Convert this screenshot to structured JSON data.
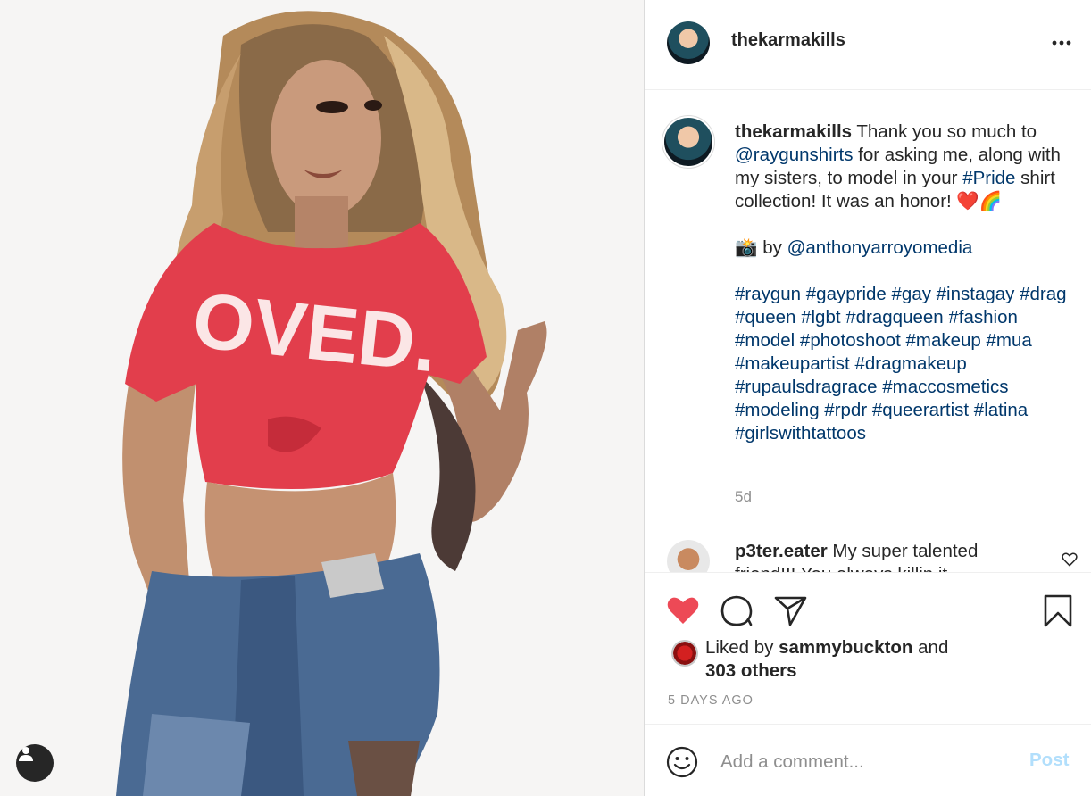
{
  "post": {
    "username": "thekarmakills",
    "shirt_text": "OVED."
  },
  "caption": {
    "username": "thekarmakills",
    "text1": " Thank you so much to ",
    "mention1": "@raygunshirts",
    "text2": " for asking me, along with my sisters, to model in your ",
    "hashtag_pride": "#Pride",
    "text3": " shirt collection! It was an honor! ❤️🌈",
    "credit_prefix": "📸 by ",
    "credit_mention": "@anthonyarroyomedia",
    "hashtags": "#raygun #gaypride #gay #instagay #drag #queen #lgbt #dragqueen #fashion #model #photoshoot #makeup #mua #makeupartist #dragmakeup #rupaulsdragrace #maccosmetics #modeling #rpdr #queerartist #latina #girlswithtattoos",
    "time": "5d"
  },
  "reply": {
    "username": "p3ter.eater",
    "text": " My super talented friend!!! You always killin it"
  },
  "likes": {
    "prefix": "Liked by ",
    "user": "sammybuckton",
    "mid": " and",
    "others": "303 others"
  },
  "timestamp": "5 DAYS AGO",
  "comment_box": {
    "placeholder": "Add a comment...",
    "post_label": "Post"
  },
  "colors": {
    "like_red": "#ed4956",
    "link_blue": "#00376b",
    "post_disabled": "#b2dffc"
  },
  "icons": [
    "more-icon",
    "heart-icon",
    "comment-icon",
    "share-icon",
    "bookmark-icon",
    "emoji-icon",
    "user-tag-icon"
  ]
}
